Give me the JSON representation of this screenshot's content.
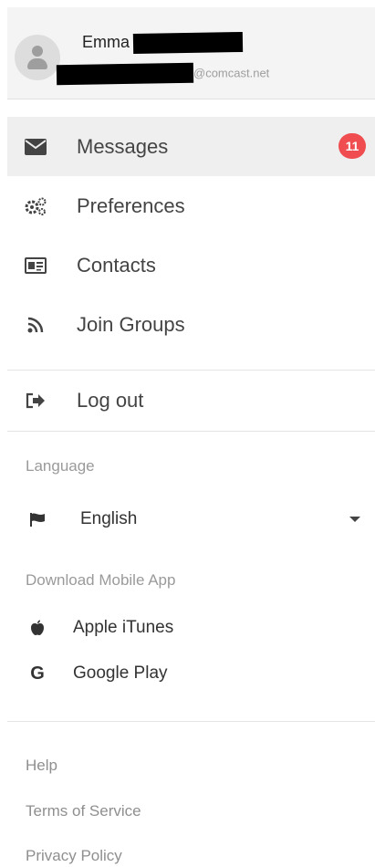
{
  "user": {
    "first_name": "Emma",
    "email_suffix": "@comcast.net"
  },
  "menu": {
    "items": [
      {
        "label": "Messages",
        "icon": "envelope-icon",
        "badge": "11"
      },
      {
        "label": "Preferences",
        "icon": "gears-icon"
      },
      {
        "label": "Contacts",
        "icon": "address-card-icon"
      },
      {
        "label": "Join Groups",
        "icon": "rss-icon"
      }
    ],
    "logout_label": "Log out"
  },
  "language": {
    "section_label": "Language",
    "selected": "English",
    "icon": "flag-icon"
  },
  "mobile_app": {
    "section_label": "Download Mobile App",
    "apple_label": "Apple iTunes",
    "google_label": "Google Play"
  },
  "footer": {
    "help": "Help",
    "terms": "Terms of Service",
    "privacy": "Privacy Policy"
  },
  "colors": {
    "badge": "#ef4d4f",
    "header_bg": "#f4f4f4",
    "active_bg": "#efefef",
    "muted_text": "#9a9a9a"
  }
}
